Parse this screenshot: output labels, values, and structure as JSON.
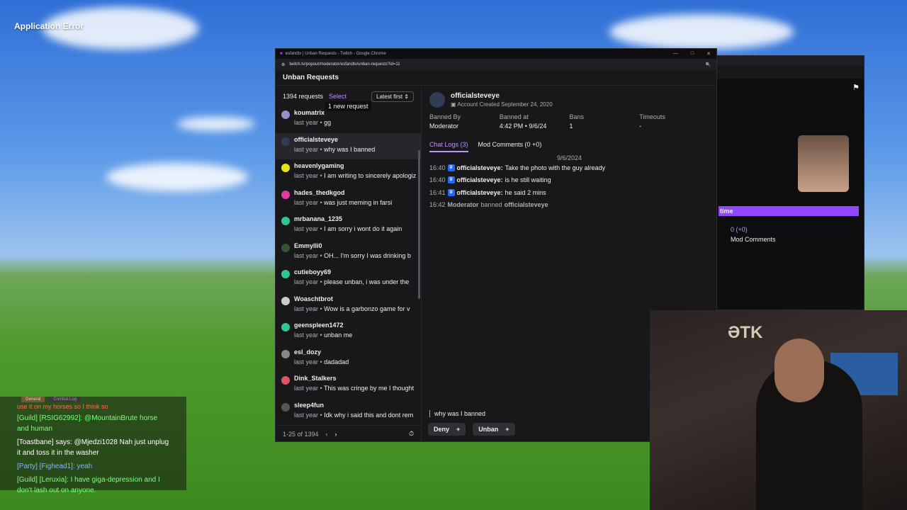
{
  "desktop": {
    "app_error": "Application Error"
  },
  "window": {
    "title": "esfandtv | Unban Requests - Twitch - Google Chrome",
    "url": "twitch.tv/popout/moderator/esfandtv/unban-requests?id=11",
    "header": "Unban Requests"
  },
  "left": {
    "count": "1394 requests",
    "select": "Select",
    "sort": "Latest first",
    "tooltip": "1 new request",
    "requests": [
      {
        "name": "koumatrix",
        "meta": "last year",
        "msg": "gg",
        "color": "#9e8ccc"
      },
      {
        "name": "officialsteveye",
        "meta": "last year",
        "msg": "why was I banned",
        "color": "#2f3e55"
      },
      {
        "name": "heavenlygaming",
        "meta": "last year",
        "msg": "I am writing to sincerely apologize",
        "color": "#e5e512"
      },
      {
        "name": "hades_thedkgod",
        "meta": "last year",
        "msg": "was just meming in farsi",
        "color": "#e23ba0"
      },
      {
        "name": "mrbanana_1235",
        "meta": "last year",
        "msg": "I am sorry i wont do it again",
        "color": "#2fc78f"
      },
      {
        "name": "Emmylli0",
        "meta": "last year",
        "msg": "OH... I'm sorry I was drinking b",
        "color": "#335533"
      },
      {
        "name": "cutieboyy69",
        "meta": "last year",
        "msg": "please unban, i was under the",
        "color": "#2fc78f"
      },
      {
        "name": "Woaschtbrot",
        "meta": "last year",
        "msg": "Wow is a garbonzo game for v",
        "color": "#cccccc"
      },
      {
        "name": "geenspleen1472",
        "meta": "last year",
        "msg": "unban me",
        "color": "#2fc78f"
      },
      {
        "name": "esl_dozy",
        "meta": "last year",
        "msg": "dadadad",
        "color": "#888888"
      },
      {
        "name": "Dink_Stalkers",
        "meta": "last year",
        "msg": "This was cringe by me I thought",
        "color": "#e05566"
      },
      {
        "name": "sleep4fun",
        "meta": "last year",
        "msg": "Idk why i said this and dont rem",
        "color": "#555555"
      }
    ],
    "pagination": "1-25 of 1394",
    "prev": "‹",
    "next": "›",
    "timer": "⏱"
  },
  "detail": {
    "username": "officialsteveye",
    "created": "Account Created September 24, 2020",
    "stats": [
      {
        "label": "Banned By",
        "value": "Moderator"
      },
      {
        "label": "Banned at",
        "value": "4:42 PM • 9/6/24"
      },
      {
        "label": "Bans",
        "value": "1"
      },
      {
        "label": "Timeouts",
        "value": "-"
      }
    ],
    "tab_chat": "Chat Logs (3)",
    "tab_mod": "Mod Comments (0 +0)",
    "log_date": "9/6/2024",
    "logs": [
      {
        "time": "16:40",
        "user": "officialsteveye:",
        "text": "Take the photo with the guy already"
      },
      {
        "time": "16:40",
        "user": "officialsteveye:",
        "text": "is he still waiting"
      },
      {
        "time": "16:41",
        "user": "officialsteveye:",
        "text": "he said 2 mins"
      }
    ],
    "mod_line": {
      "time": "16:42",
      "mod": "Moderator",
      "verb": "banned",
      "target": "officialsteveye"
    },
    "composer": "why was I banned",
    "deny": "Deny",
    "unban": "Unban",
    "plus": "+"
  },
  "bgwindow": {
    "purple_text": "time",
    "count": "0 (+0)",
    "mod_comments": "Mod Comments"
  },
  "cam": {
    "logo": "ƏTK"
  },
  "gamechat": {
    "tab_general": "General",
    "tab_combat": "Combat Log",
    "cut_line": "use it on my horses so I think so",
    "lines": [
      {
        "text": "[Guild] [RSIG62992]: @MountainBrute horse and human",
        "cls": "guild"
      },
      {
        "text": "[Toastbane] says: @Mjedzi1028 Nah just unplug it and toss it in the washer",
        "cls": "say"
      },
      {
        "text": "[Party] [Fighead1]: yeah",
        "cls": "party"
      },
      {
        "text": "[Guild] [Leruxia]: I have giga-depression and I don't lash out on anyone.",
        "cls": "guild"
      }
    ]
  }
}
